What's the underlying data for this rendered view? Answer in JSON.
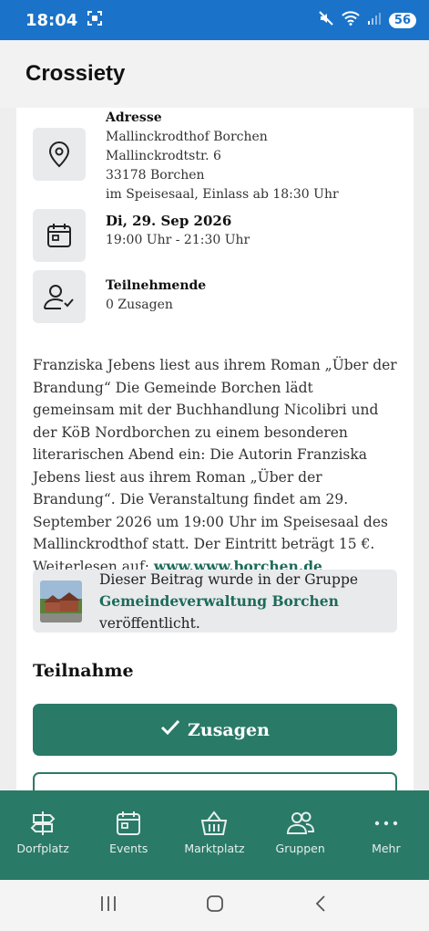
{
  "status_bar": {
    "time": "18:04",
    "battery": "56"
  },
  "header": {
    "title": "Crossiety"
  },
  "event": {
    "address": {
      "label": "Adresse",
      "lines": [
        "Mallinckrodthof Borchen",
        "Mallinckrodtstr. 6",
        "33178 Borchen",
        "im Speisesaal, Einlass ab 18:30 Uhr"
      ]
    },
    "date": {
      "label": "Di, 29. Sep 2026",
      "time": "19:00 Uhr - 21:30 Uhr"
    },
    "participants": {
      "label": "Teilnehmende",
      "count": "0 Zusagen"
    },
    "description": "Franziska Jebens liest aus ihrem Roman „Über der Brandung“ Die Gemeinde Borchen lädt gemeinsam mit der Buchhandlung Nicolibri und der KöB Nordborchen zu einem besonderen literarischen Abend ein: Die Autorin Franziska Jebens liest aus ihrem Roman „Über der Brandung“. Die Veranstaltung findet am 29. September 2026 um 19:00 Uhr im Speisesaal des Mallinckrodthof statt. Der Eintritt beträgt 15 €. Weiterlesen auf: ",
    "link_text": "www.www.borchen.de"
  },
  "group_notice": {
    "prefix": "Dieser Beitrag wurde in der Gruppe",
    "group_name": "Gemeindeverwaltung Borchen",
    "suffix": "veröffentlicht."
  },
  "participation": {
    "title": "Teilnahme",
    "accept_label": "Zusagen"
  },
  "bottom_nav": {
    "items": [
      {
        "label": "Dorfplatz",
        "icon": "signpost-icon"
      },
      {
        "label": "Events",
        "icon": "calendar-icon"
      },
      {
        "label": "Marktplatz",
        "icon": "basket-icon"
      },
      {
        "label": "Gruppen",
        "icon": "people-icon"
      },
      {
        "label": "Mehr",
        "icon": "more-icon"
      }
    ]
  },
  "colors": {
    "status_bar": "#1a73c9",
    "primary": "#2a7a68",
    "link": "#1d6b5a"
  }
}
